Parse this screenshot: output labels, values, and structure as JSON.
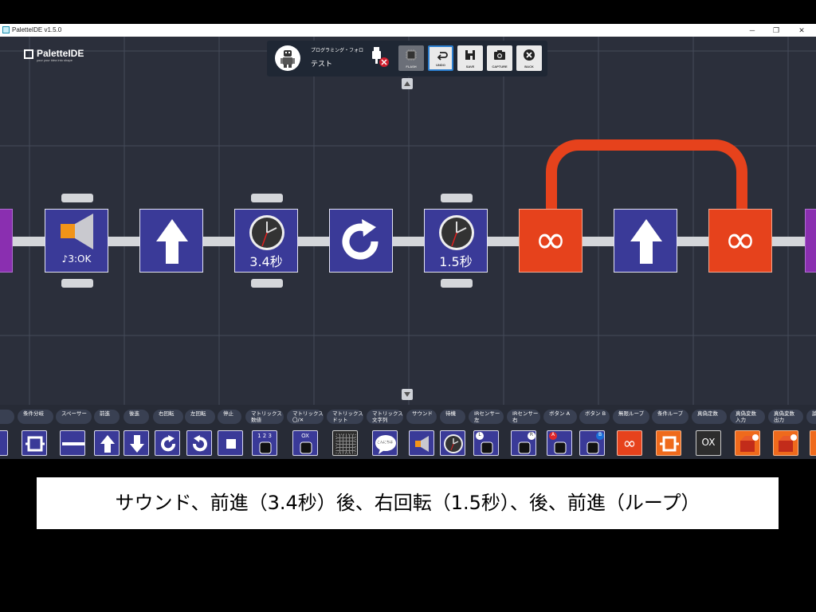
{
  "window": {
    "title": "PaletteIDE v1.5.0",
    "minimize_icon": "minimize-icon",
    "maximize_icon": "restore-icon",
    "close_icon": "close-icon"
  },
  "logo": {
    "name": "PaletteIDE",
    "tagline": "your your idea into shape"
  },
  "robot": {
    "title": "プログラミング・フォロ",
    "name": "テスト",
    "connection_status": "disconnected"
  },
  "toolbar": {
    "flash": "FLASH",
    "undo": "UNDO",
    "save": "SAVE",
    "capture": "CAPTURE",
    "back": "BACK"
  },
  "program": {
    "blocks": [
      {
        "type": "sound",
        "label": "♪3:OK",
        "color": "#3a3a98"
      },
      {
        "type": "forward",
        "label": "",
        "color": "#3a3a98"
      },
      {
        "type": "wait",
        "label": "3.4秒",
        "color": "#3a3a98"
      },
      {
        "type": "turn-right",
        "label": "",
        "color": "#3a3a98"
      },
      {
        "type": "wait",
        "label": "1.5秒",
        "color": "#3a3a98"
      },
      {
        "type": "loop-start",
        "label": "∞",
        "color": "#e6421c"
      },
      {
        "type": "forward",
        "label": "",
        "color": "#3a3a98"
      },
      {
        "type": "loop-end",
        "label": "∞",
        "color": "#e6421c"
      }
    ]
  },
  "palette": {
    "items": [
      {
        "label": "ック",
        "icon": "loop-block-icon"
      },
      {
        "label": "条件分岐",
        "icon": "branch-icon"
      },
      {
        "label": "スペーサー",
        "icon": "spacer-icon"
      },
      {
        "label": "前進",
        "icon": "arrow-up-icon"
      },
      {
        "label": "後進",
        "icon": "arrow-down-icon"
      },
      {
        "label": "右回転",
        "icon": "rotate-right-icon"
      },
      {
        "label": "左回転",
        "icon": "rotate-left-icon"
      },
      {
        "label": "停止",
        "icon": "stop-icon"
      },
      {
        "label": "マトリックス\n数値",
        "icon": "matrix-number-icon",
        "text": "1 2 3"
      },
      {
        "label": "マトリックス\n〇/✕",
        "icon": "matrix-ox-icon",
        "text": "OX"
      },
      {
        "label": "マトリックス\nドット",
        "icon": "matrix-dot-icon"
      },
      {
        "label": "マトリックス\n文字列",
        "icon": "speech-bubble-icon",
        "text": "こんにちは"
      },
      {
        "label": "サウンド",
        "icon": "speaker-icon"
      },
      {
        "label": "待機",
        "icon": "clock-icon"
      },
      {
        "label": "IRセンサー\n左",
        "icon": "ir-left-icon",
        "text": "L"
      },
      {
        "label": "IRセンサー\n右",
        "icon": "ir-right-icon",
        "text": "R"
      },
      {
        "label": "ボタン A",
        "icon": "button-a-icon",
        "text": "A"
      },
      {
        "label": "ボタン B",
        "icon": "button-b-icon",
        "text": "B"
      },
      {
        "label": "無限ループ",
        "icon": "infinite-loop-icon"
      },
      {
        "label": "条件ループ",
        "icon": "conditional-loop-icon"
      },
      {
        "label": "真偽定数",
        "icon": "true-false-icon",
        "text": "OX"
      },
      {
        "label": "真偽変数\n入力",
        "icon": "variable-input-icon"
      },
      {
        "label": "真偽変数\n出力",
        "icon": "variable-output-icon"
      },
      {
        "label": "論",
        "icon": "logic-icon"
      }
    ]
  },
  "caption": "サウンド、前進（3.4秒）後、右回転（1.5秒）、後、前進（ループ）",
  "colors": {
    "canvas_bg": "#2b2f3b",
    "block_blue": "#3a3a98",
    "loop_orange": "#e6421c",
    "track": "#d4d6da"
  }
}
